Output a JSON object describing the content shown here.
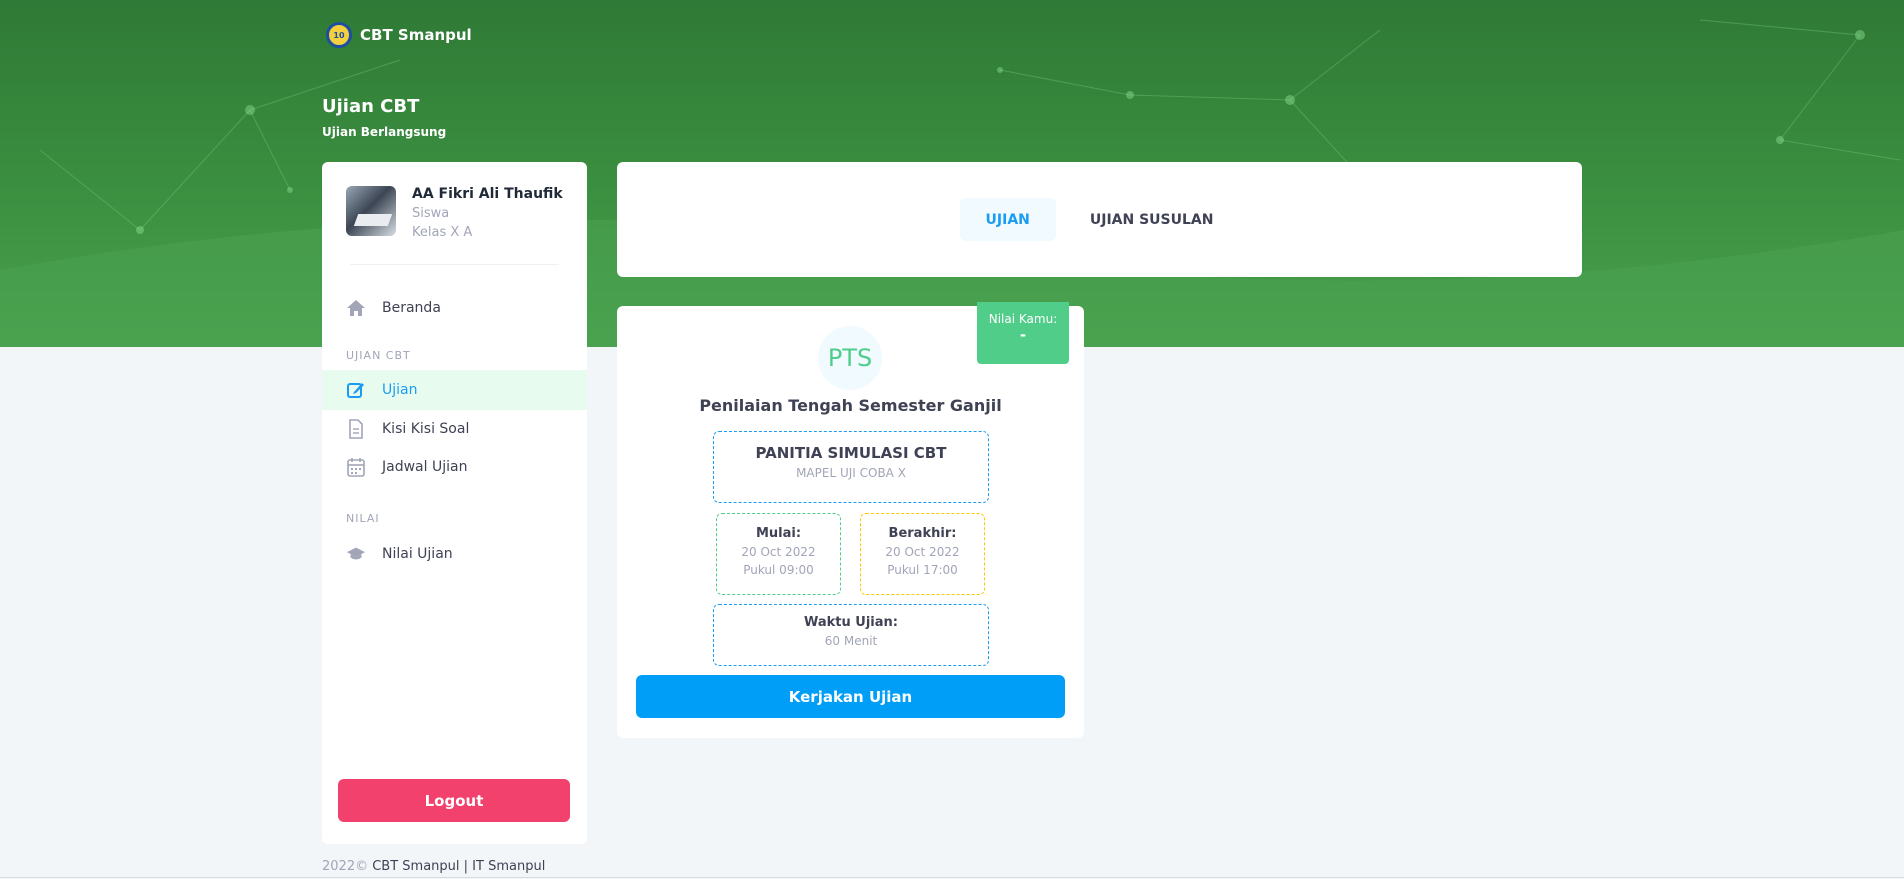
{
  "brand": {
    "name": "CBT Smanpul",
    "logo_text": "10"
  },
  "page": {
    "title": "Ujian CBT",
    "subtitle": "Ujian  Berlangsung"
  },
  "user": {
    "name": "AA Fikri Ali Thaufik",
    "role": "Siswa",
    "class": "Kelas X A"
  },
  "sidebar": {
    "home_label": "Beranda",
    "section_cbt": "UJIAN CBT",
    "items": [
      {
        "label": "Ujian",
        "icon": "edit-icon",
        "active": true
      },
      {
        "label": "Kisi Kisi Soal",
        "icon": "document-icon"
      },
      {
        "label": "Jadwal Ujian",
        "icon": "calendar-icon"
      }
    ],
    "section_nilai": "NILAI",
    "nilai_label": "Nilai Ujian",
    "logout_label": "Logout"
  },
  "tabs": [
    {
      "label": "UJIAN",
      "active": true
    },
    {
      "label": "UJIAN SUSULAN",
      "active": false
    }
  ],
  "exam": {
    "score_label": "Nilai Kamu:",
    "score_value": "-",
    "code": "PTS",
    "title": "Penilaian Tengah Semester Ganjil",
    "organizer": "PANITIA SIMULASI CBT",
    "subject": "MAPEL UJI COBA X",
    "start_label": "Mulai:",
    "start_date": "20 Oct 2022",
    "start_time": "Pukul 09:00",
    "end_label": "Berakhir:",
    "end_date": "20 Oct 2022",
    "end_time": "Pukul 17:00",
    "duration_label": "Waktu Ujian:",
    "duration_value": "60 Menit",
    "button_label": "Kerjakan Ujian"
  },
  "footer": {
    "year": "2022©",
    "text": "CBT Smanpul | IT Smanpul"
  },
  "colors": {
    "primary": "#009ef7",
    "success": "#50cd89",
    "danger": "#f1416c",
    "warning": "#ffc700",
    "hero_green": "#3b8f40"
  }
}
